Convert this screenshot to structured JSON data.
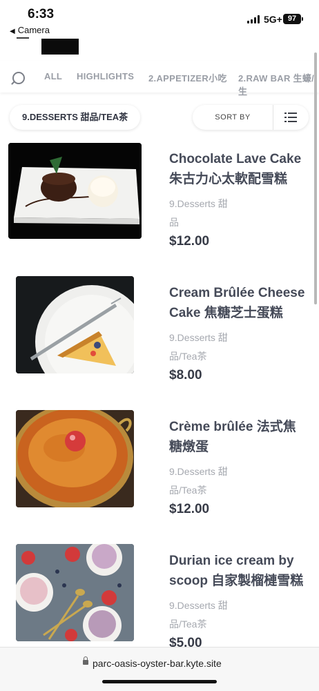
{
  "status_bar": {
    "time": "6:33",
    "back_app": "Camera",
    "network": "5G+",
    "battery": "97"
  },
  "nav": {
    "categories": [
      "ALL",
      "HIGHLIGHTS",
      "2.APPETIZER小吃",
      "2.RAW BAR 生蠔/生"
    ]
  },
  "toolbar": {
    "current_category": "9.DESSERTS 甜品/TEA茶",
    "sort_label": "SORT BY"
  },
  "items": [
    {
      "title_line1": "Chocolate Lave Cake",
      "title_line2": "朱古力心太軟配雪糕",
      "category_line1": "9.Desserts 甜",
      "category_line2": "品",
      "price": "$12.00"
    },
    {
      "title_line1": "Cream Brûlée Cheese",
      "title_line2": "Cake 焦糖芝士蛋糕",
      "category_line1": "9.Desserts 甜",
      "category_line2": "品/Tea茶",
      "price": "$8.00"
    },
    {
      "title_line1": "Crème brûlée 法式焦",
      "title_line2": "糖燉蛋",
      "category_line1": "9.Desserts 甜",
      "category_line2": "品/Tea茶",
      "price": "$12.00"
    },
    {
      "title_line1": "Durian ice cream by",
      "title_line2": "scoop 自家製榴槤雪糕",
      "category_line1": "9.Desserts 甜",
      "category_line2": "品/Tea茶",
      "price": "$5.00"
    }
  ],
  "browser": {
    "url": "parc-oasis-oyster-bar.kyte.site"
  },
  "colors": {
    "text_dark": "#454a58",
    "text_muted": "#a5a8af",
    "nav_text": "#9a9ea6"
  }
}
